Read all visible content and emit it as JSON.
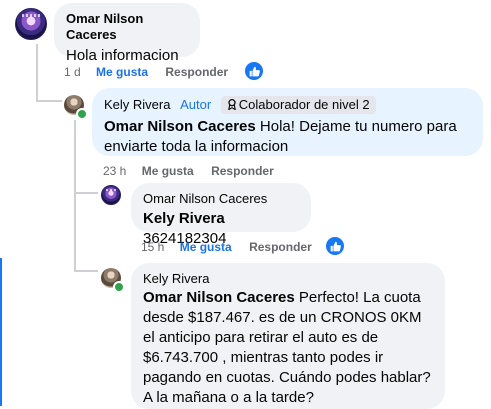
{
  "comments": [
    {
      "author": "Omar Nilson Caceres",
      "text": "Hola informacion",
      "time": "1 d",
      "like_label": "Me gusta",
      "reply_label": "Responder"
    },
    {
      "author": "Kely Rivera",
      "role": "Autor",
      "badge": "Colaborador de nivel 2",
      "mention": "Omar Nilson Caceres",
      "text": "Hola! Dejame tu numero para enviarte toda la informacion",
      "time": "23 h",
      "like_label": "Me gusta",
      "reply_label": "Responder"
    },
    {
      "author": "Omar Nilson Caceres",
      "mention": "Kely Rivera",
      "text": "3624182304",
      "time": "15 h",
      "like_label": "Me gusta",
      "reply_label": "Responder"
    },
    {
      "author": "Kely Rivera",
      "mention": "Omar Nilson Caceres",
      "text": "Perfecto! La cuota desde $187.467. es de un CRONOS 0KM el anticipo para retirar el auto es de $6.743.700 , mientras tanto podes ir pagando en cuotas. Cuándo podes hablar? A la mañana o a la tarde?"
    }
  ],
  "colors": {
    "accent": "#1b74e4",
    "bubble": "#f0f2f5",
    "bubble_author": "#e7f3ff"
  },
  "icons": {
    "reaction": "like-thumb-icon",
    "badge": "contributor-badge-icon",
    "online": "online-status-dot"
  }
}
